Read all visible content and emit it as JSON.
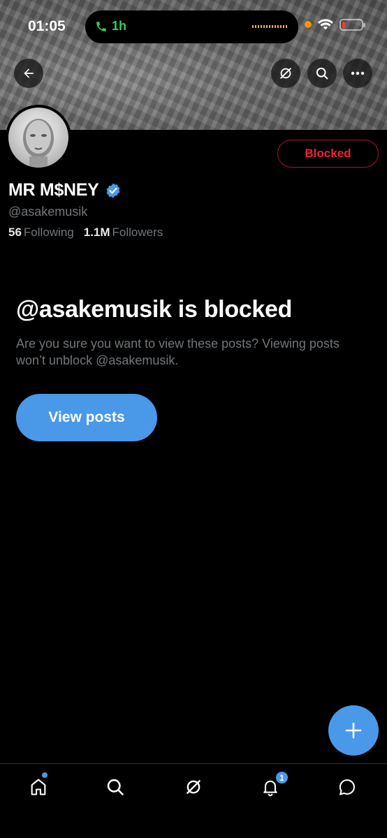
{
  "status_bar": {
    "time": "01:05",
    "call_duration": "1h"
  },
  "header": {
    "back_icon": "arrow-left-icon",
    "grok_icon": "grok-icon",
    "search_icon": "search-icon",
    "more_icon": "ellipsis-icon"
  },
  "profile": {
    "display_name": "MR M$NEY",
    "verified": true,
    "handle": "@asakemusik",
    "following_count": "56",
    "following_label": "Following",
    "followers_count": "1.1M",
    "followers_label": "Followers",
    "action_button": "Blocked"
  },
  "blocked_notice": {
    "title": "@asakemusik is blocked",
    "description": "Are you sure you want to view these posts? Viewing posts won’t unblock @asakemusik.",
    "button": "View posts"
  },
  "tabbar": {
    "items": [
      "home",
      "search",
      "grok",
      "notifications",
      "messages"
    ],
    "notification_count": "1"
  },
  "colors": {
    "accent": "#4a99e9",
    "blocked_red": "#f4212e",
    "muted_text": "#71767b"
  }
}
